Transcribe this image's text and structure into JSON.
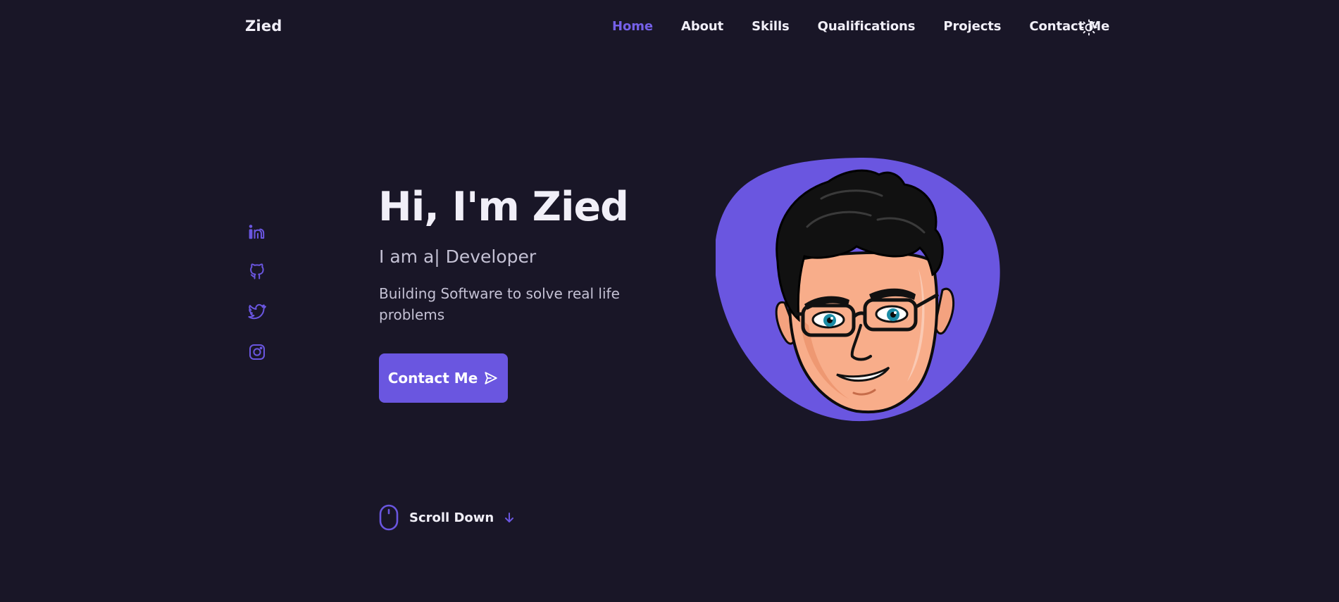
{
  "header": {
    "logo": "Zied",
    "nav": [
      {
        "label": "Home",
        "active": true
      },
      {
        "label": "About",
        "active": false
      },
      {
        "label": "Skills",
        "active": false
      },
      {
        "label": "Qualifications",
        "active": false
      },
      {
        "label": "Projects",
        "active": false
      },
      {
        "label": "Contact Me",
        "active": false
      }
    ],
    "theme_toggle_icon": "sun-icon"
  },
  "social": [
    {
      "icon": "linkedin-icon"
    },
    {
      "icon": "github-icon"
    },
    {
      "icon": "twitter-icon"
    },
    {
      "icon": "instagram-icon"
    }
  ],
  "hero": {
    "title": "Hi, I'm Zied",
    "subtitle": "I am a| Developer",
    "description": "Building Software to solve real life problems",
    "button_label": "Contact Me",
    "button_icon": "send-icon",
    "avatar_icon": "avatar-illustration"
  },
  "scroll": {
    "label": "Scroll Down",
    "icon": "mouse-icon",
    "arrow_icon": "arrow-down-icon"
  },
  "colors": {
    "background": "#191627",
    "accent": "#6a56e0",
    "text": "#f1eff8",
    "muted_text": "#c4c1d4"
  }
}
